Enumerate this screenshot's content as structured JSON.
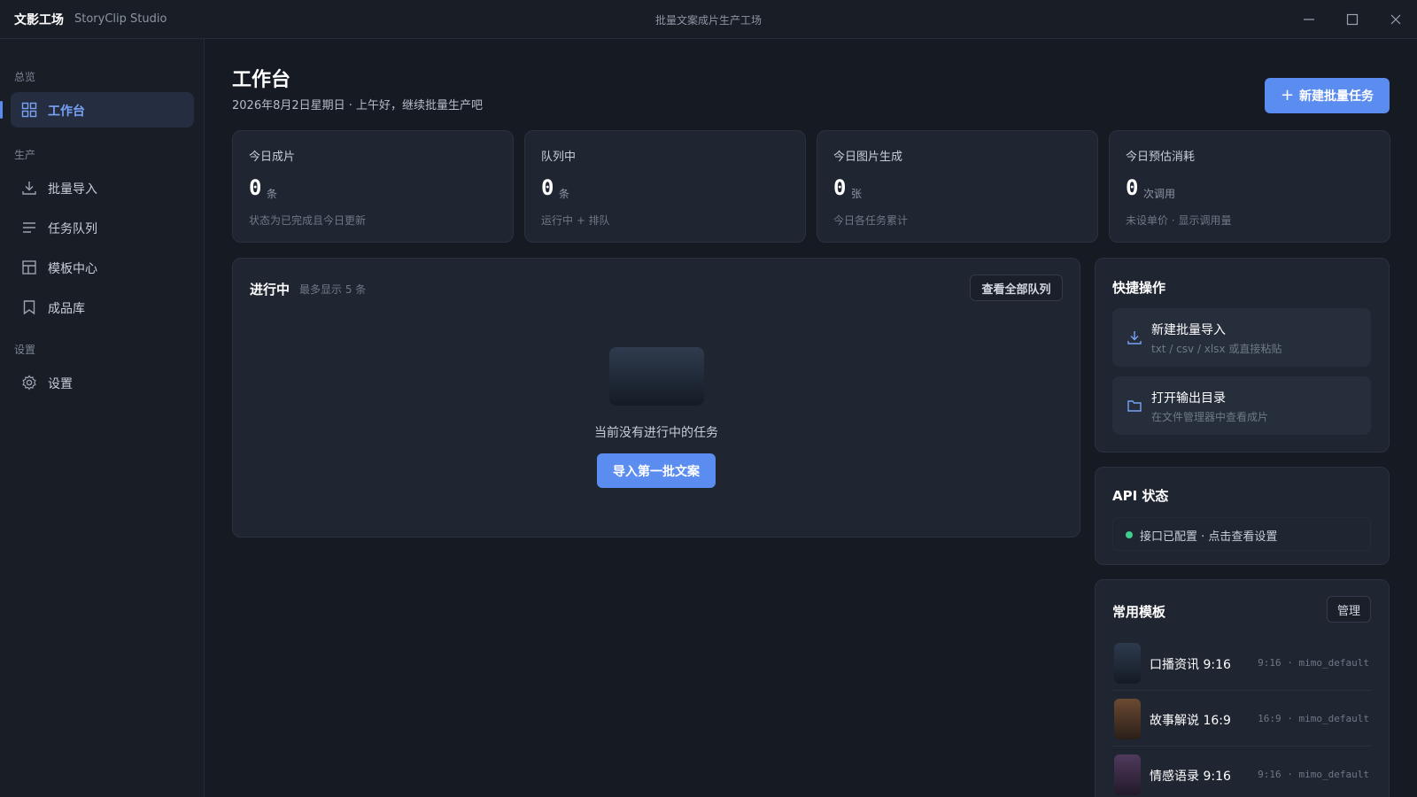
{
  "window": {
    "brand": "文影工场",
    "brand_sub": "StoryClip Studio",
    "title": "批量文案成片生产工场"
  },
  "sidebar": {
    "sections": [
      "总览",
      "生产",
      "设置"
    ],
    "items": [
      {
        "label": "工作台",
        "icon": "dashboard-icon",
        "active": true
      },
      {
        "label": "批量导入",
        "icon": "download-icon"
      },
      {
        "label": "任务队列",
        "icon": "list-icon"
      },
      {
        "label": "模板中心",
        "icon": "template-icon"
      },
      {
        "label": "成品库",
        "icon": "bookmark-icon"
      },
      {
        "label": "设置",
        "icon": "gear-icon"
      }
    ]
  },
  "header": {
    "title": "工作台",
    "subtitle": "2026年8月2日星期日 · 上午好，继续批量生产吧",
    "new_task_label": "新建批量任务"
  },
  "stats": [
    {
      "label": "今日成片",
      "value": "0",
      "unit": "条",
      "note": "状态为已完成且今日更新"
    },
    {
      "label": "队列中",
      "value": "0",
      "unit": "条",
      "note": "运行中 + 排队"
    },
    {
      "label": "今日图片生成",
      "value": "0",
      "unit": "张",
      "note": "今日各任务累计"
    },
    {
      "label": "今日预估消耗",
      "value": "0",
      "unit": "次调用",
      "note": "未设单价 · 显示调用量"
    }
  ],
  "in_progress": {
    "title": "进行中",
    "subtitle": "最多显示 5 条",
    "view_all_label": "查看全部队列",
    "empty_text": "当前没有进行中的任务",
    "import_label": "导入第一批文案"
  },
  "quick_actions": {
    "title": "快捷操作",
    "items": [
      {
        "title": "新建批量导入",
        "desc": "txt / csv / xlsx 或直接粘贴",
        "icon": "download-icon"
      },
      {
        "title": "打开输出目录",
        "desc": "在文件管理器中查看成片",
        "icon": "folder-icon"
      }
    ]
  },
  "api_status": {
    "title": "API 状态",
    "text": "接口已配置 · 点击查看设置",
    "status_color": "#3ecf8e"
  },
  "templates": {
    "title": "常用模板",
    "manage_label": "管理",
    "items": [
      {
        "name": "口播资讯 9:16",
        "meta": "9:16 · mimo_default",
        "thumb_color": "#1e2a3a"
      },
      {
        "name": "故事解说 16:9",
        "meta": "16:9 · mimo_default",
        "thumb_color": "#4a3424"
      },
      {
        "name": "情感语录 9:16",
        "meta": "9:16 · mimo_default",
        "thumb_color": "#3a2a44"
      }
    ]
  },
  "colors": {
    "accent": "#5b8cf0",
    "background": "#151a23",
    "card": "#1f2531",
    "success": "#3ecf8e"
  }
}
